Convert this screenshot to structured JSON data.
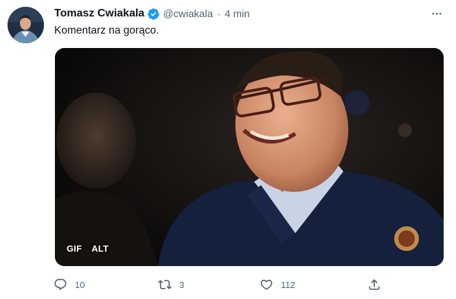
{
  "tweet": {
    "author_name": "Tomasz Cwiakala",
    "handle": "@cwiakala",
    "separator": "·",
    "time": "4 min",
    "text": "Komentarz na gorąco."
  },
  "media": {
    "badge_gif": "GIF",
    "badge_alt": "ALT"
  },
  "actions": {
    "replies": "10",
    "retweets": "3",
    "likes": "112"
  },
  "icons": {
    "verified": "verified-badge-icon",
    "more": "more-horizontal-icon",
    "reply": "reply-icon",
    "retweet": "retweet-icon",
    "like": "heart-icon",
    "share": "share-icon"
  },
  "colors": {
    "verified_blue": "#1d9bf0",
    "secondary_text": "#536471",
    "primary_text": "#0f1419"
  }
}
